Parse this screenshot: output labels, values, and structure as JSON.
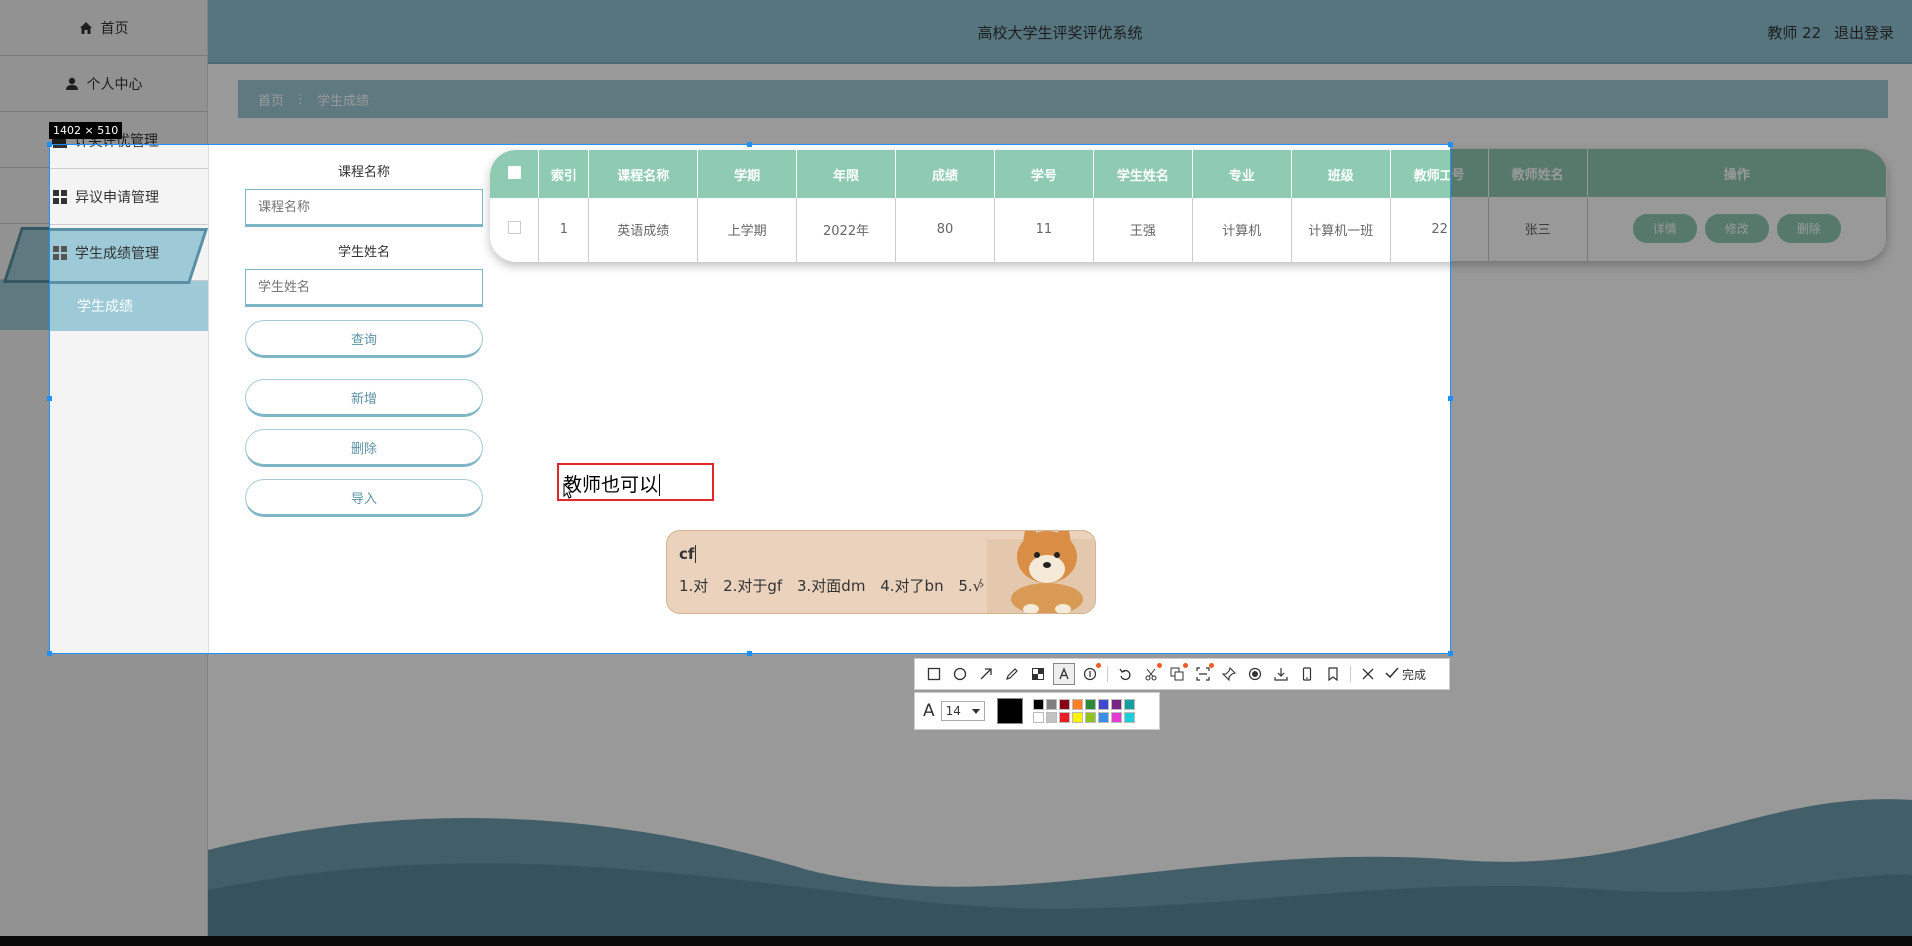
{
  "sidebar": {
    "items": [
      {
        "label": "首页",
        "icon": "home-icon"
      },
      {
        "label": "个人中心",
        "icon": "user-icon"
      },
      {
        "label": "计奖评优管理",
        "icon": "square-icon"
      },
      {
        "label": "异议申请管理",
        "icon": "grid-icon"
      },
      {
        "label": "学生成绩管理",
        "icon": "grid-icon"
      }
    ],
    "sub_item": "学生成绩"
  },
  "header": {
    "title": "高校大学生评奖评优系统",
    "user": "教师 22",
    "logout": "退出登录"
  },
  "breadcrumb": {
    "home": "首页",
    "sep": "⋮",
    "current": "学生成绩"
  },
  "search": {
    "course_label": "课程名称",
    "course_placeholder": "课程名称",
    "student_label": "学生姓名",
    "student_placeholder": "学生姓名",
    "query_button": "查询",
    "add_button": "新增",
    "delete_button": "删除",
    "import_button": "导入"
  },
  "table": {
    "headers": [
      "索引",
      "课程名称",
      "学期",
      "年限",
      "成绩",
      "学号",
      "学生姓名",
      "专业",
      "班级",
      "教师工号",
      "教师姓名",
      "操作"
    ],
    "rows": [
      {
        "cells": [
          "1",
          "英语成绩",
          "上学期",
          "2022年",
          "80",
          "11",
          "王强",
          "计算机",
          "计算机一班",
          "22",
          "张三"
        ]
      }
    ],
    "actions": [
      "详情",
      "修改",
      "删除"
    ]
  },
  "selection": {
    "size_label": "1402 × 510"
  },
  "annotation": {
    "text": "教师也可以"
  },
  "ime": {
    "input": "cf",
    "candidates": [
      "1.对",
      "2.对于gf",
      "3.对面dm",
      "4.对了bn",
      "5.√"
    ],
    "next": "›"
  },
  "toolbar": {
    "done_label": "完成",
    "font_size": "14",
    "current_color": "#000000",
    "palette": [
      "#000000",
      "#7f7f7f",
      "#880015",
      "#ff7f27",
      "#2d8a3b",
      "#3f48cc",
      "#7a2585",
      "#14a0a0",
      "#ffffff",
      "#c3c3c3",
      "#ed1c24",
      "#fff200",
      "#8fc31f",
      "#3a8ee6",
      "#e43bd4",
      "#1dcdd8"
    ]
  },
  "colors": {
    "accent": "#8fcab2",
    "header": "#8fc4d2",
    "selection_border": "#1e90ff",
    "annotation_border": "#e0282b"
  }
}
